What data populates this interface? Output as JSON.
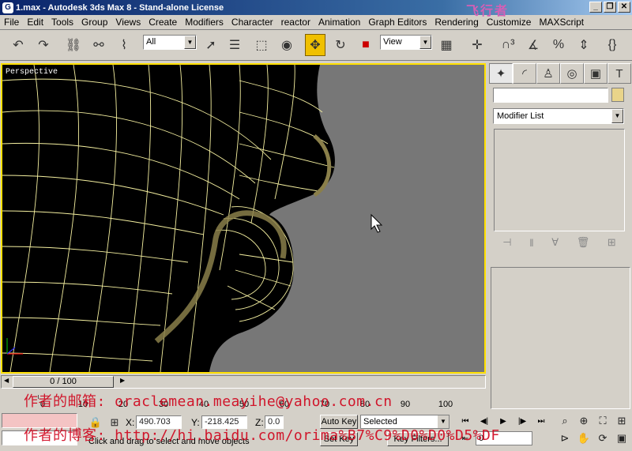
{
  "window": {
    "title": "1.max - Autodesk 3ds Max 8 - Stand-alone License",
    "icon_letter": "G",
    "controls": [
      "minimize",
      "maximize",
      "close"
    ]
  },
  "menu": [
    "File",
    "Edit",
    "Tools",
    "Group",
    "Views",
    "Create",
    "Modifiers",
    "Character",
    "reactor",
    "Animation",
    "Graph Editors",
    "Rendering",
    "Customize",
    "MAXScript"
  ],
  "toolbar": {
    "selection_filter": "All",
    "reference_coord": "View",
    "icons": [
      "undo-icon",
      "redo-icon",
      "select-link-icon",
      "unlink-icon",
      "bind-spacewarp-icon",
      "select-object-icon",
      "select-by-name-icon",
      "selection-region-icon",
      "window-crossing-icon",
      "select-move-icon",
      "select-rotate-icon",
      "select-scale-icon",
      "pivot-icon",
      "snap-3d-icon",
      "angle-snap-icon",
      "percent-snap-icon",
      "spinner-snap-icon",
      "edit-named-selections-icon"
    ]
  },
  "viewport": {
    "label": "Perspective",
    "active_border_color": "#ffe000",
    "background_color": "#777777",
    "wire_color": "#f5f0a0"
  },
  "command_panel": {
    "tabs": [
      "create-tab",
      "modify-tab",
      "hierarchy-tab",
      "motion-tab",
      "display-tab",
      "utilities-tab"
    ],
    "selected_tab": 0,
    "object_name": "",
    "color_swatch": "#e9d48a",
    "modifier_list": "Modifier List"
  },
  "time_slider": {
    "position_text": "0 / 100",
    "ticks": [
      "0",
      "10",
      "20",
      "30",
      "40",
      "50",
      "60",
      "70",
      "80",
      "90",
      "100"
    ]
  },
  "status": {
    "x_label": "X:",
    "x_value": "490.703",
    "y_label": "Y:",
    "y_value": "-218.425",
    "z_label": "Z:",
    "z_value": "0.0",
    "prompt": "Click and drag to select and move objects",
    "auto_key": "Auto Key",
    "set_key": "Set Key",
    "key_mode": "Selected",
    "key_filters": "Key Filters...",
    "current_frame": "0"
  },
  "watermark": {
    "line1": "作者的邮箱: oraclemean.meayihe@yahoo.com.cn",
    "line2": "作者的博客: http://hi.baidu.com/orima%B7%C9%D0%D0%D5%DF"
  },
  "title_decoration": "飞行者"
}
